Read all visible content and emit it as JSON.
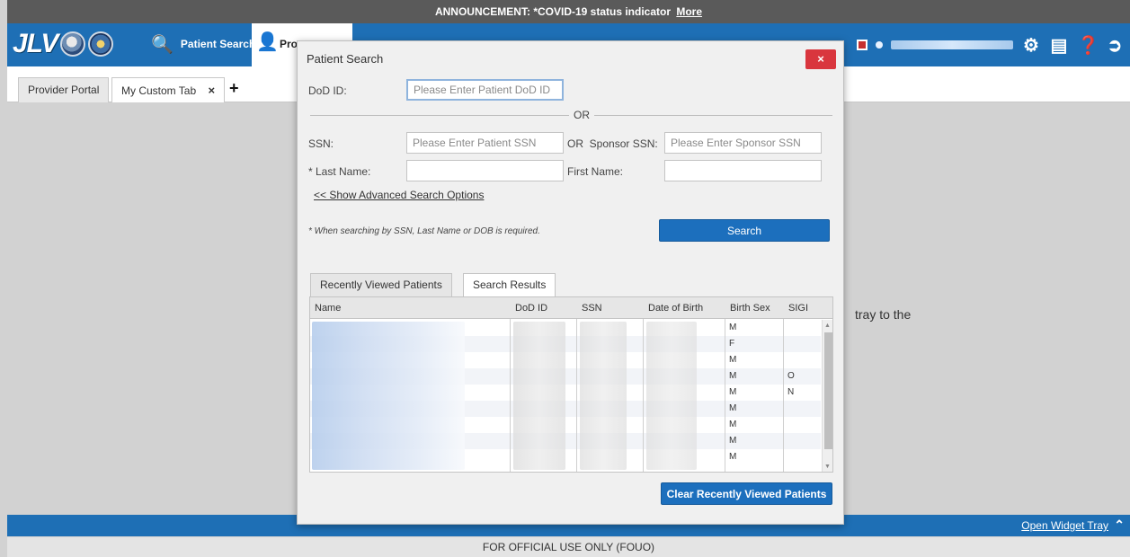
{
  "announcement": {
    "label": "ANNOUNCEMENT:",
    "text": "*COVID-19 status indicator",
    "link": "More"
  },
  "header": {
    "logo_text": "JLV",
    "patient_search_label": "Patient Search",
    "active_tab_label": "Pro"
  },
  "tabs": {
    "provider_portal": "Provider Portal",
    "custom_tab": "My Custom Tab",
    "close_glyph": "×",
    "add_glyph": "+"
  },
  "workspace": {
    "visible_text": "tray to the"
  },
  "modal": {
    "title": "Patient Search",
    "close_glyph": "×",
    "dod_id_label": "DoD ID:",
    "dod_id_placeholder": "Please Enter Patient DoD ID",
    "or_text": "OR",
    "ssn_label": "SSN:",
    "ssn_placeholder": "Please Enter Patient SSN",
    "sponsor_label": "OR  Sponsor SSN:",
    "sponsor_placeholder": "Please Enter Sponsor SSN",
    "last_name_label": "* Last Name:",
    "first_name_label": "First Name:",
    "advanced_link": "<< Show Advanced Search Options",
    "note": "* When searching by SSN, Last Name or DOB is required.",
    "search_button": "Search",
    "result_tabs": [
      "Recently Viewed Patients",
      "Search Results"
    ],
    "columns": [
      "Name",
      "DoD ID",
      "SSN",
      "Date of Birth",
      "Birth Sex",
      "SIGI"
    ],
    "rows": [
      {
        "birth_sex": "M",
        "sigi": ""
      },
      {
        "birth_sex": "F",
        "sigi": ""
      },
      {
        "birth_sex": "M",
        "sigi": ""
      },
      {
        "birth_sex": "M",
        "sigi": "O"
      },
      {
        "birth_sex": "M",
        "sigi": "N"
      },
      {
        "birth_sex": "M",
        "sigi": ""
      },
      {
        "birth_sex": "M",
        "sigi": ""
      },
      {
        "birth_sex": "M",
        "sigi": ""
      },
      {
        "birth_sex": "M",
        "sigi": ""
      }
    ],
    "clear_button": "Clear Recently Viewed Patients"
  },
  "bottom": {
    "widget_tray_link": "Open Widget Tray",
    "chevron": "^"
  },
  "footer": {
    "text": "FOR OFFICIAL USE ONLY (FOUO)"
  }
}
